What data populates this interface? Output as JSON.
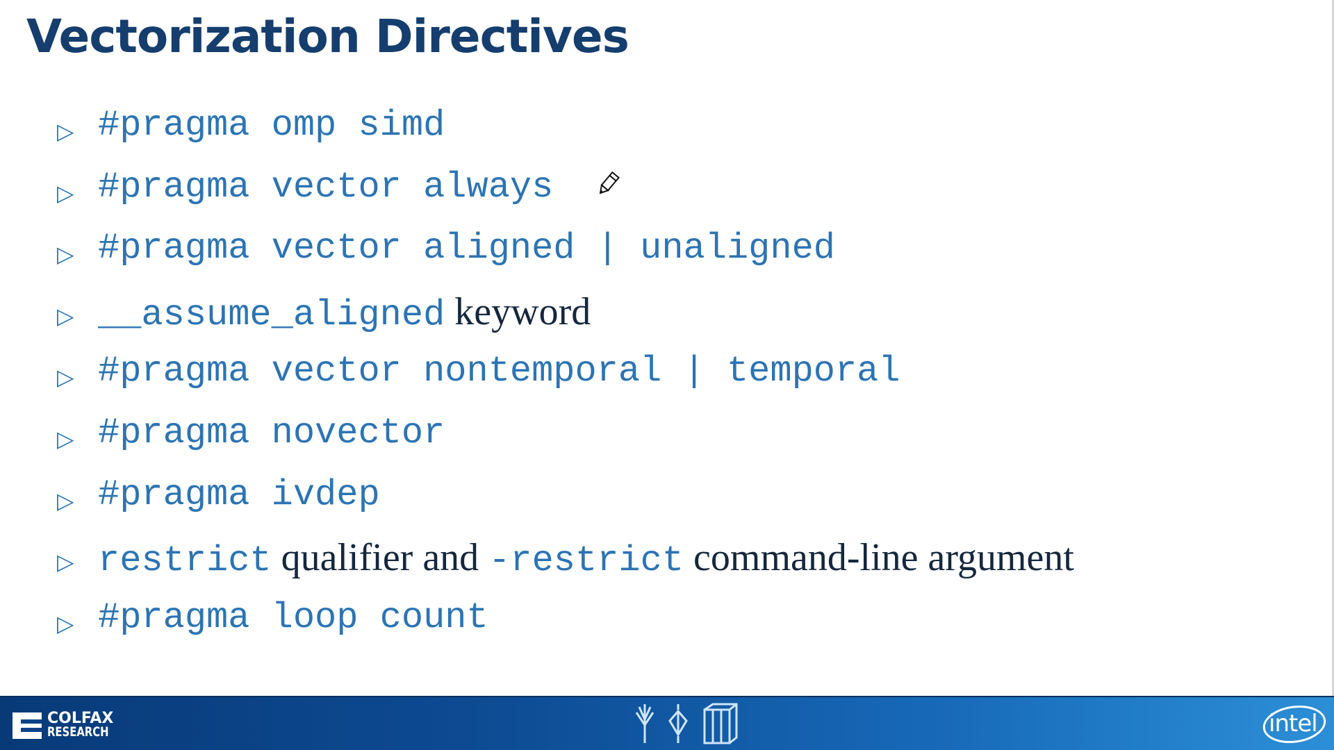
{
  "slide": {
    "title": "Vectorization Directives",
    "bullet_glyph": "▷",
    "items": [
      {
        "parts": [
          {
            "style": "code",
            "text": "#pragma omp simd"
          }
        ]
      },
      {
        "parts": [
          {
            "style": "code",
            "text": "#pragma vector always"
          }
        ]
      },
      {
        "parts": [
          {
            "style": "code",
            "text": "#pragma vector aligned | unaligned"
          }
        ]
      },
      {
        "parts": [
          {
            "style": "code",
            "text": "__assume_aligned"
          },
          {
            "style": "text",
            "text": " keyword"
          }
        ]
      },
      {
        "parts": [
          {
            "style": "code",
            "text": "#pragma vector nontemporal | temporal"
          }
        ]
      },
      {
        "parts": [
          {
            "style": "code",
            "text": "#pragma novector"
          }
        ]
      },
      {
        "parts": [
          {
            "style": "code",
            "text": "#pragma ivdep"
          }
        ]
      },
      {
        "parts": [
          {
            "style": "code",
            "text": "restrict"
          },
          {
            "style": "text",
            "text": " qualifier and "
          },
          {
            "style": "code",
            "text": "-restrict"
          },
          {
            "style": "text",
            "text": " command-line argument"
          }
        ]
      },
      {
        "parts": [
          {
            "style": "code",
            "text": "#pragma loop count"
          }
        ]
      }
    ]
  },
  "footer": {
    "left_logo": {
      "line1": "COLFAX",
      "line2": "RESEARCH"
    },
    "center_icons": [
      "tree-icon",
      "diamond-pin-icon",
      "cube-frame-icon"
    ],
    "right_logo": "intel"
  },
  "overlay": {
    "cursor_icon": "pencil-cursor-icon"
  },
  "colors": {
    "title": "#153e6e",
    "code": "#2c74b4",
    "text": "#15273d",
    "footer_left": "#083a78",
    "footer_right": "#2c8fd6"
  }
}
